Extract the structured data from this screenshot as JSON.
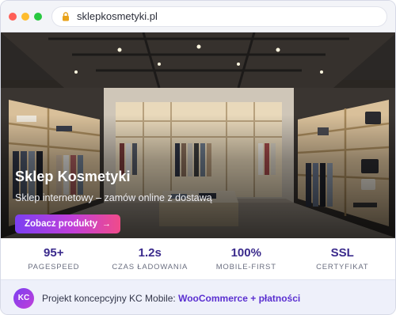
{
  "browser": {
    "url": "sklepkosmetyki.pl",
    "icons": {
      "lock": "lock-icon"
    }
  },
  "hero": {
    "title": "Sklep Kosmetyki",
    "subtitle": "Sklep internetowy – zamów online z dostawą",
    "cta_label": "Zobacz produkty",
    "cta_icon": "→",
    "cta_gradient": [
      "#7b3ff2",
      "#c13fd8",
      "#f04b8a"
    ]
  },
  "stats": [
    {
      "value": "95+",
      "label": "PAGESPEED"
    },
    {
      "value": "1.2s",
      "label": "CZAS ŁADOWANIA"
    },
    {
      "value": "100%",
      "label": "MOBILE-FIRST"
    },
    {
      "value": "SSL",
      "label": "CERTYFIKAT"
    }
  ],
  "footer": {
    "badge": "KC",
    "text": "Projekt koncepcyjny KC Mobile:",
    "highlight": "WooCommerce + płatności"
  },
  "colors": {
    "accent": "#3a2a8c",
    "link": "#5a2fd0",
    "footer_bg": "#eef0fa"
  }
}
